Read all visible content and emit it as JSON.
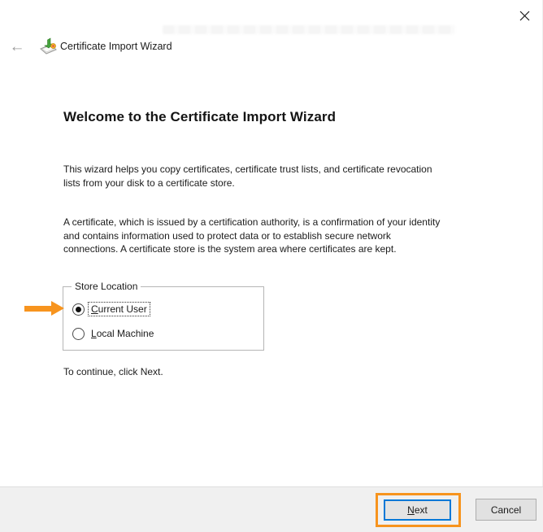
{
  "header": {
    "title": "Certificate Import Wizard"
  },
  "main": {
    "heading": "Welcome to the Certificate Import Wizard",
    "para1_line1": "This wizard helps you copy certificates, certificate trust lists, and certificate revocation",
    "para1_line2": "lists from your disk to a certificate store.",
    "para2_line1": "A certificate, which is issued by a certification authority, is a confirmation of your identity",
    "para2_line2": "and contains information used to protect data or to establish secure network",
    "para2_line3": "connections. A certificate store is the system area where certificates are kept.",
    "instruction": "To continue, click Next."
  },
  "store_location": {
    "group_label": "Store Location",
    "options": [
      {
        "mnemonic": "C",
        "rest": "urrent User",
        "label": "Current User",
        "selected": true
      },
      {
        "mnemonic": "L",
        "rest": "ocal Machine",
        "label": "Local Machine",
        "selected": false
      }
    ]
  },
  "footer": {
    "next_mnemonic": "N",
    "next_rest": "ext",
    "next_label": "Next",
    "cancel_label": "Cancel"
  },
  "annotation": {
    "color": "#F7941E",
    "highlighted_option": "Current User",
    "highlighted_button": "Next"
  }
}
